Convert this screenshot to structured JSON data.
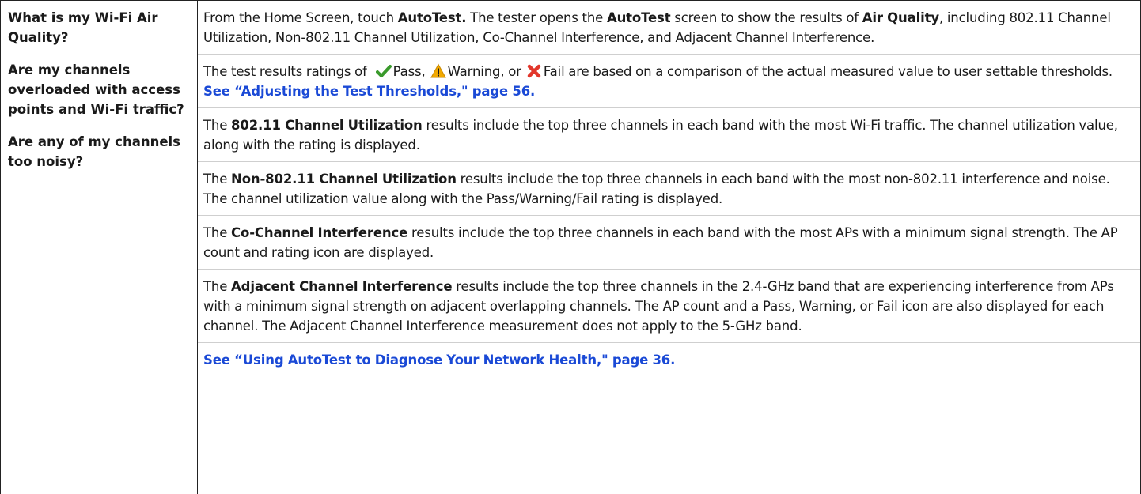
{
  "questions": [
    "What is my Wi-Fi Air Quality?",
    "Are my channels overloaded with access points and Wi-Fi traffic?",
    "Are any of my channels too noisy?"
  ],
  "p1": {
    "t1": "From the Home Screen, touch ",
    "b1": "AutoTest.",
    "t2": " The tester opens the ",
    "b2": "AutoTest",
    "t3": " screen to show the results of ",
    "b3": "Air Quality",
    "t4": ", including 802.11 Channel Utilization, Non-802.11 Channel Utilization, Co-Channel Interference, and Adjacent Channel Interference."
  },
  "p2": {
    "t1": "The test results ratings of ",
    "pass": "Pass,",
    "warning": "Warning, or",
    "fail": "Fail are based on a comparison of the actual measured value to user settable thresholds. ",
    "link": "See “Adjusting the Test Thresholds,\" page 56."
  },
  "p3": {
    "t1": "The ",
    "b1": "802.11 Channel Utilization",
    "t2": " results include the top three channels in each band with the most Wi-Fi traffic. The channel utilization value, along with the rating is displayed."
  },
  "p4": {
    "t1": "The ",
    "b1": "Non-802.11 Channel Utilization",
    "t2": " results include the top three channels in each band with the most non-802.11 interference and noise. The channel utilization value along with the Pass/Warning/Fail rating is displayed."
  },
  "p5": {
    "t1": "The ",
    "b1": "Co-Channel Interference",
    "t2": " results include the top three channels in each band with the most APs with a minimum signal strength. The AP count and rating icon are displayed."
  },
  "p6": {
    "t1": "The ",
    "b1": "Adjacent Channel Interference",
    "t2": " results include the top three channels in the 2.4-GHz band that are experiencing interference from APs with a minimum signal strength on adjacent overlapping channels. The AP count and a Pass, Warning, or Fail icon are also displayed for each channel. The Adjacent Channel Interference measurement does not apply to the 5-GHz band."
  },
  "p7": {
    "link": "See “Using AutoTest to Diagnose Your Network Health,\" page 36."
  },
  "icons": {
    "pass": "checkmark-icon",
    "warning": "warning-triangle-icon",
    "fail": "x-mark-icon"
  },
  "colors": {
    "link": "#1a49d6",
    "pass": "#3a9a2c",
    "warning": "#f2a900",
    "fail": "#e2372c"
  }
}
